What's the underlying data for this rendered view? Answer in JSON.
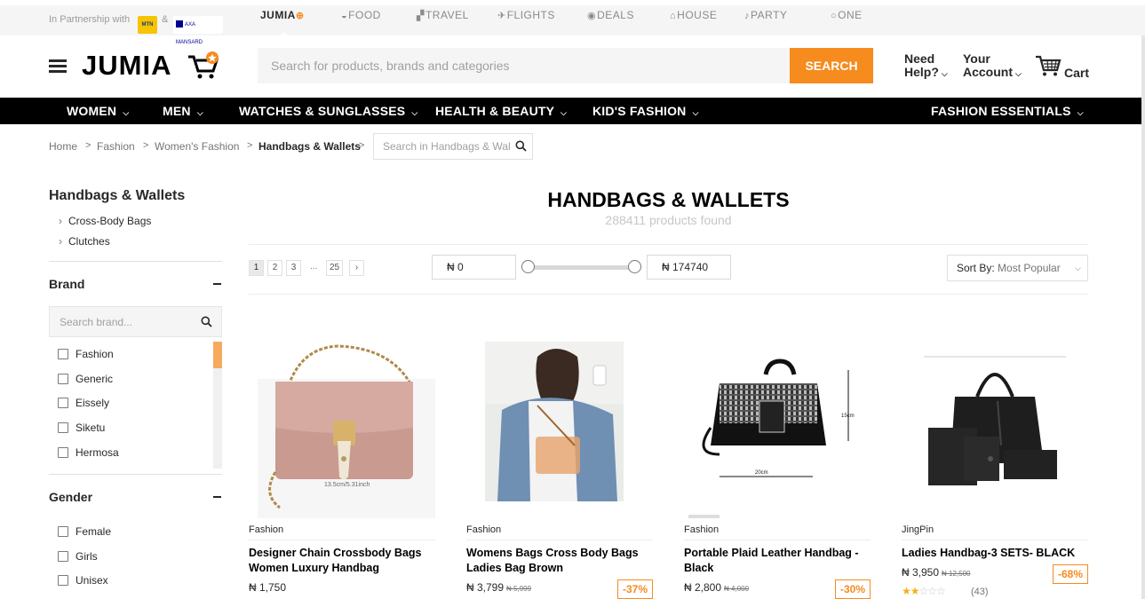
{
  "topbar": {
    "partnership": "In Partnership with",
    "mtn_logo": "MTN",
    "amp": "&",
    "axa_logo": "AXA MANSARD",
    "services": [
      {
        "label": "JUMIA",
        "icon": "cart-mini-icon"
      },
      {
        "label": "FOOD",
        "icon": "food-icon"
      },
      {
        "label": "TRAVEL",
        "icon": "travel-icon"
      },
      {
        "label": "FLIGHTS",
        "icon": "flights-icon"
      },
      {
        "label": "DEALS",
        "icon": "deals-icon"
      },
      {
        "label": "HOUSE",
        "icon": "house-icon"
      },
      {
        "label": "PARTY",
        "icon": "party-icon"
      },
      {
        "label": "ONE",
        "icon": "one-icon"
      }
    ]
  },
  "header": {
    "logo": "JUMIA",
    "search_placeholder": "Search for products, brands and categories",
    "search_button": "SEARCH",
    "help_line1": "Need",
    "help_line2": "Help?",
    "account_line1": "Your",
    "account_line2": "Account",
    "cart": "Cart"
  },
  "nav": {
    "items": [
      "WOMEN",
      "MEN",
      "WATCHES & SUNGLASSES",
      "HEALTH & BEAUTY",
      "KID'S FASHION"
    ],
    "right": "FASHION ESSENTIALS"
  },
  "breadcrumb": {
    "items": [
      "Home",
      "Fashion",
      "Women's Fashion",
      "Handbags & Wallets"
    ],
    "sep": ">",
    "search_placeholder": "Search in Handbags & Wal"
  },
  "sidebar": {
    "category_title": "Handbags & Wallets",
    "subcategories": [
      "Cross-Body Bags",
      "Clutches"
    ],
    "brand_title": "Brand",
    "brand_search_placeholder": "Search brand...",
    "brands": [
      "Fashion",
      "Generic",
      "Eissely",
      "Siketu",
      "Hermosa"
    ],
    "gender_title": "Gender",
    "genders": [
      "Female",
      "Girls",
      "Unisex"
    ]
  },
  "main": {
    "title": "HANDBAGS & WALLETS",
    "count": "288411 products found",
    "pages": [
      "1",
      "2",
      "3",
      "...",
      "25"
    ],
    "next": "›",
    "price_min": "₦ 0",
    "price_max": "₦ 174740",
    "price_range_fraction": [
      0,
      1
    ],
    "sort_label": "Sort By:",
    "sort_value": "Most Popular"
  },
  "products": [
    {
      "brand": "Fashion",
      "name": "Designer Chain Crossbody Bags Women Luxury Handbag",
      "price": "₦ 1,750",
      "old_price": "",
      "discount": "",
      "img_text": "13.5cm/5.31inch"
    },
    {
      "brand": "Fashion",
      "name": "Womens Bags Cross Body Bags Ladies Bag Brown",
      "price": "₦ 3,799",
      "old_price": "₦ 5,999",
      "discount": "-37%"
    },
    {
      "brand": "Fashion",
      "name": "Portable Plaid Leather Handbag - Black",
      "price": "₦ 2,800",
      "old_price": "₦ 4,000",
      "discount": "-30%"
    },
    {
      "brand": "JingPin",
      "name": "Ladies Handbag-3 SETS- BLACK",
      "price": "₦ 3,950",
      "old_price": "₦ 12,500",
      "discount": "-68%",
      "rating": 2,
      "reviews": "(43)"
    }
  ],
  "colors": {
    "accent": "#f68b1e",
    "nav_bg": "#000000",
    "text": "#282828"
  }
}
